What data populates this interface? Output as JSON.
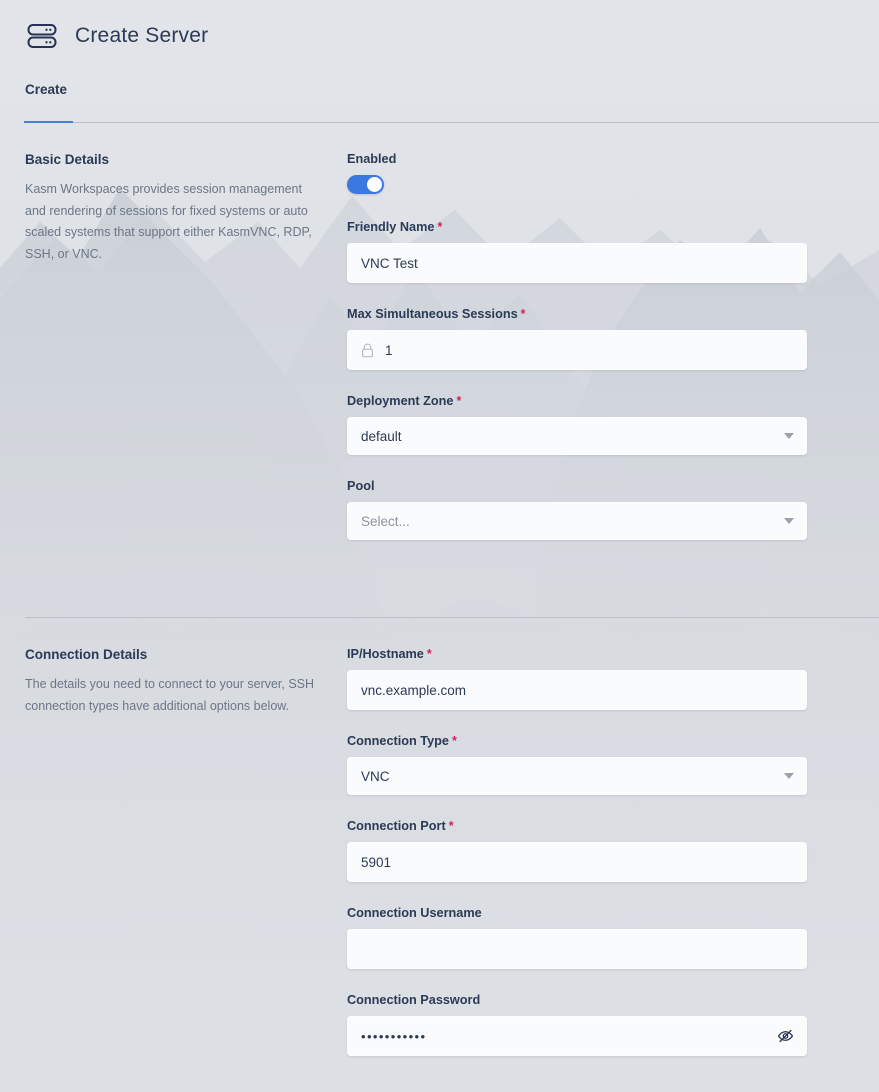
{
  "header": {
    "title": "Create Server",
    "icon": "server-rack-icon"
  },
  "tabs": [
    {
      "label": "Create",
      "active": true
    }
  ],
  "colors": {
    "accent_blue": "#3b78e0",
    "tab_underline": "#4a7fd4",
    "required_asterisk": "#d31f62",
    "label_text": "#2b3a55",
    "body_text": "#6c7686",
    "page_background": "#dde0e5",
    "input_background": "#fafbfc"
  },
  "sections": [
    {
      "title": "Basic Details",
      "description": "Kasm Workspaces provides session management and rendering of sessions for fixed systems or auto scaled systems that support either KasmVNC, RDP, SSH, or VNC.",
      "fields": [
        {
          "label": "Enabled",
          "required": false,
          "type": "toggle",
          "value": "on"
        },
        {
          "label": "Friendly Name",
          "required": true,
          "type": "text",
          "value": "VNC Test",
          "placeholder": ""
        },
        {
          "label": "Max Simultaneous Sessions",
          "required": true,
          "type": "text-locked",
          "value": "1",
          "placeholder": "",
          "icon": "lock-icon"
        },
        {
          "label": "Deployment Zone",
          "required": true,
          "type": "select",
          "value": "default",
          "placeholder": ""
        },
        {
          "label": "Pool",
          "required": false,
          "type": "select",
          "value": "",
          "placeholder": "Select..."
        }
      ]
    },
    {
      "title": "Connection Details",
      "description": "The details you need to connect to your server, SSH connection types have additional options below.",
      "fields": [
        {
          "label": "IP/Hostname",
          "required": true,
          "type": "text",
          "value": "vnc.example.com",
          "placeholder": ""
        },
        {
          "label": "Connection Type",
          "required": true,
          "type": "select",
          "value": "VNC",
          "placeholder": ""
        },
        {
          "label": "Connection Port",
          "required": true,
          "type": "text",
          "value": "5901",
          "placeholder": ""
        },
        {
          "label": "Connection Username",
          "required": false,
          "type": "text",
          "value": "",
          "placeholder": ""
        },
        {
          "label": "Connection Password",
          "required": false,
          "type": "password",
          "value": "•••••••••••",
          "placeholder": "",
          "icon": "eye-slash-icon"
        }
      ]
    }
  ]
}
